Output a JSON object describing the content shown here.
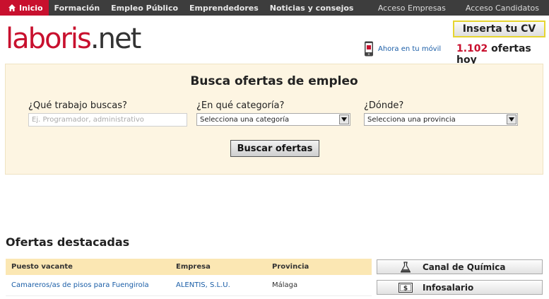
{
  "topnav": {
    "items": [
      {
        "label": "Inicio",
        "active": true
      },
      {
        "label": "Formación"
      },
      {
        "label": "Empleo Público"
      },
      {
        "label": "Emprendedores"
      },
      {
        "label": "Noticias y consejos"
      }
    ],
    "right": [
      "Acceso Empresas",
      "Acceso Candidatos"
    ]
  },
  "header": {
    "logo_part1": "laboris",
    "logo_part2": ".net",
    "cv_button": "Inserta tu CV",
    "mobile_link": "Ahora en tu móvil",
    "offers_count": "1.102",
    "offers_suffix": " ofertas hoy"
  },
  "search": {
    "title": "Busca ofertas de empleo",
    "job_label": "¿Qué trabajo buscas?",
    "job_placeholder": "Ej. Programador, administrativo",
    "category_label": "¿En qué categoría?",
    "category_value": "Selecciona una categoría",
    "where_label": "¿Dónde?",
    "where_value": "Selecciona una provincia",
    "button": "Buscar ofertas"
  },
  "featured": {
    "title": "Ofertas destacadas",
    "columns": [
      "Puesto vacante",
      "Empresa",
      "Provincia"
    ],
    "rows": [
      [
        "Camareros/as de pisos para Fuengirola",
        "ALENTIS, S.L.U.",
        "Málaga"
      ]
    ]
  },
  "sidebar": {
    "buttons": [
      "Canal de Química",
      "Infosalario"
    ]
  },
  "colors": {
    "brand": "#c8102e",
    "link": "#1b5ea7",
    "nav_bg": "#3d3d3d",
    "search_bg": "#fdf5e2",
    "table_header_bg": "#fbe7b3"
  }
}
